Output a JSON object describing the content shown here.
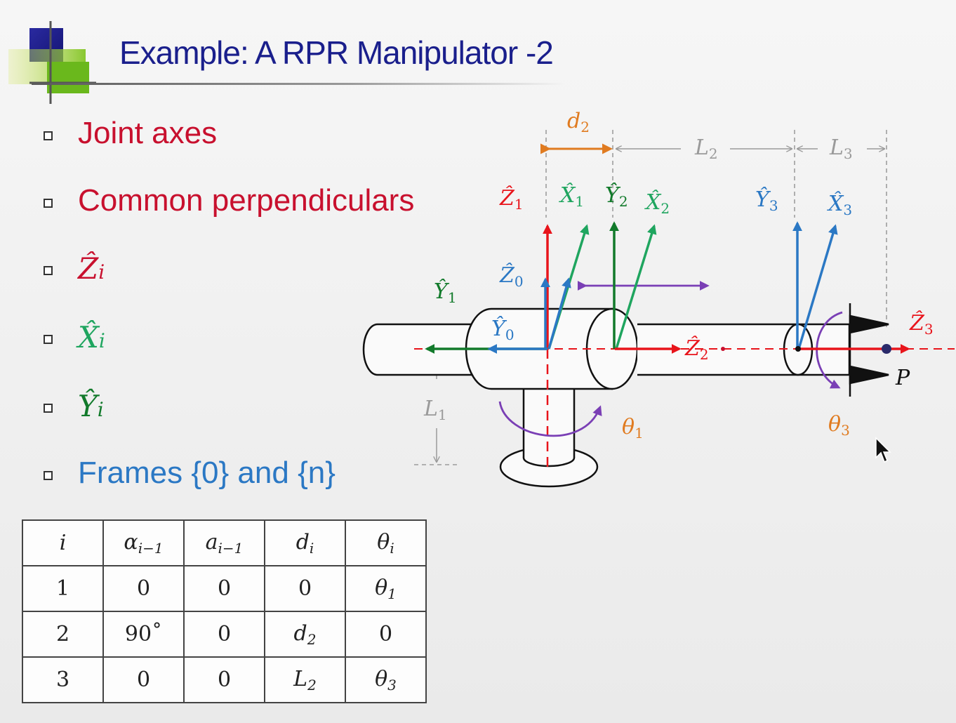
{
  "slide": {
    "title": "Example: A RPR Manipulator -2",
    "bullets": [
      {
        "text": "Joint axes",
        "color": "#c8102e",
        "kind": "text"
      },
      {
        "text": "Common perpendiculars",
        "color": "#c8102e",
        "kind": "text"
      },
      {
        "text": "Ẑ",
        "sub": "i",
        "color": "#c8102e",
        "kind": "math"
      },
      {
        "text": "X̂",
        "sub": "i",
        "color": "#1fa55f",
        "kind": "math"
      },
      {
        "text": "Ŷ",
        "sub": "i",
        "color": "#127a2b",
        "kind": "math"
      },
      {
        "text": "Frames {0} and {n}",
        "color": "#2b78c4",
        "kind": "text"
      }
    ]
  },
  "diagram": {
    "labels": {
      "d2": {
        "main": "d",
        "sub": "2"
      },
      "L2": {
        "main": "L",
        "sub": "2"
      },
      "L3": {
        "main": "L",
        "sub": "3"
      },
      "L1": {
        "main": "L",
        "sub": "1"
      },
      "Z1": {
        "main": "Ẑ",
        "sub": "1"
      },
      "X1": {
        "main": "X̂",
        "sub": "1"
      },
      "Y2": {
        "main": "Ŷ",
        "sub": "2"
      },
      "X2": {
        "main": "X̂",
        "sub": "2"
      },
      "Y3": {
        "main": "Ŷ",
        "sub": "3"
      },
      "X3": {
        "main": "X̂",
        "sub": "3"
      },
      "Z0": {
        "main": "Ẑ",
        "sub": "0"
      },
      "Y1": {
        "main": "Ŷ",
        "sub": "1"
      },
      "Y0": {
        "main": "Ŷ",
        "sub": "0"
      },
      "Z2": {
        "main": "Ẑ",
        "sub": "2"
      },
      "Z3": {
        "main": "Ẑ",
        "sub": "3"
      },
      "theta1": {
        "main": "θ",
        "sub": "1"
      },
      "theta3": {
        "main": "θ",
        "sub": "3"
      },
      "P": {
        "main": "P"
      }
    },
    "colors": {
      "z": "#e8141b",
      "x": "#1fa55f",
      "y_dark": "#127a2b",
      "blue": "#2b78c4",
      "orange": "#e07b20",
      "purple": "#7a3fb5",
      "dim_gray": "#9a9a9a"
    }
  },
  "dh_table": {
    "headers": [
      {
        "main": "i",
        "sub": ""
      },
      {
        "main": "α",
        "sub": "i−1"
      },
      {
        "main": "a",
        "sub": "i−1"
      },
      {
        "main": "d",
        "sub": "i"
      },
      {
        "main": "θ",
        "sub": "i"
      }
    ],
    "rows": [
      {
        "i": "1",
        "alpha": "0",
        "a": "0",
        "d": {
          "main": "0",
          "sub": "",
          "style": "plain"
        },
        "theta": {
          "main": "θ",
          "sub": "1",
          "style": "orange"
        }
      },
      {
        "i": "2",
        "alpha": "90˚",
        "a": "0",
        "d": {
          "main": "d",
          "sub": "2",
          "style": "orange"
        },
        "theta": {
          "main": "0",
          "sub": "",
          "style": "plain"
        }
      },
      {
        "i": "3",
        "alpha": "0",
        "a": "0",
        "d": {
          "main": "L",
          "sub": "2",
          "style": "crimson"
        },
        "theta": {
          "main": "θ",
          "sub": "3",
          "style": "orange"
        }
      }
    ]
  }
}
